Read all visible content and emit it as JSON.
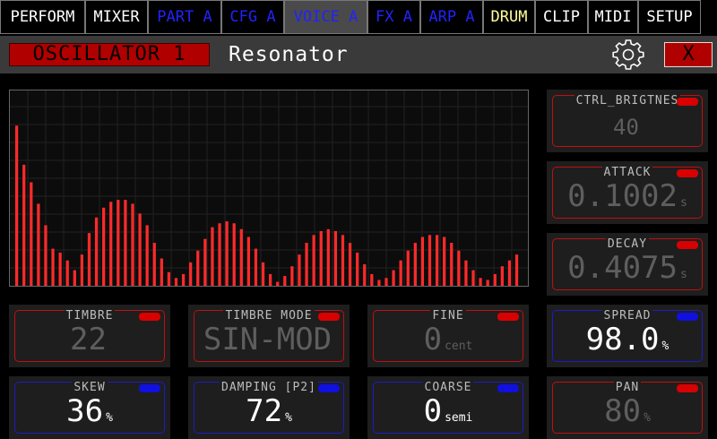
{
  "tabs": [
    {
      "label": "PERFORM",
      "color": "#ffffff",
      "active": false
    },
    {
      "label": "MIXER",
      "color": "#ffffff",
      "active": false
    },
    {
      "label": "PART A",
      "color": "#2222ff",
      "active": false
    },
    {
      "label": "CFG A",
      "color": "#2222ff",
      "active": false
    },
    {
      "label": "VOICE A",
      "color": "#2222ff",
      "active": true
    },
    {
      "label": "FX A",
      "color": "#2222ff",
      "active": false
    },
    {
      "label": "ARP A",
      "color": "#2222ff",
      "active": false
    },
    {
      "label": "DRUM",
      "color": "#ffff99",
      "active": false
    },
    {
      "label": "CLIP",
      "color": "#ffffff",
      "active": false
    },
    {
      "label": "MIDI",
      "color": "#ffffff",
      "active": false
    },
    {
      "label": "SETUP",
      "color": "#ffffff",
      "active": false
    }
  ],
  "header": {
    "oscillator_label": "OSCILLATOR 1",
    "model_name": "Resonator",
    "gear_icon": "gear-icon",
    "close_label": "X"
  },
  "spectrum": {
    "bar_color": "#ff2a2a",
    "levels": [
      0.82,
      0.62,
      0.53,
      0.42,
      0.31,
      0.19,
      0.17,
      0.13,
      0.08,
      0.16,
      0.27,
      0.35,
      0.4,
      0.43,
      0.44,
      0.44,
      0.42,
      0.37,
      0.31,
      0.22,
      0.14,
      0.07,
      0.04,
      0.06,
      0.12,
      0.18,
      0.24,
      0.3,
      0.32,
      0.33,
      0.32,
      0.29,
      0.25,
      0.19,
      0.12,
      0.06,
      0.02,
      0.05,
      0.1,
      0.16,
      0.22,
      0.26,
      0.28,
      0.29,
      0.28,
      0.26,
      0.22,
      0.17,
      0.11,
      0.06,
      0.03,
      0.04,
      0.08,
      0.13,
      0.18,
      0.22,
      0.25,
      0.26,
      0.26,
      0.25,
      0.22,
      0.18,
      0.13,
      0.08,
      0.04,
      0.03,
      0.06,
      0.1,
      0.13,
      0.16
    ]
  },
  "params": [
    {
      "label": "CTRL_BRIGTNES",
      "value": "40",
      "unit": "",
      "color": "red",
      "size": "small"
    },
    {
      "label": "ATTACK",
      "value": "0.1002",
      "unit": "s",
      "color": "red",
      "size": "large"
    },
    {
      "label": "DECAY",
      "value": "0.4075",
      "unit": "s",
      "color": "red",
      "size": "large"
    },
    {
      "label": "TIMBRE",
      "value": "22",
      "unit": "",
      "color": "red",
      "size": "large"
    },
    {
      "label": "TIMBRE MODE",
      "value": "SIN-MOD",
      "unit": "",
      "color": "red",
      "size": "large"
    },
    {
      "label": "FINE",
      "value": "0",
      "unit": "cent",
      "color": "red",
      "size": "large"
    },
    {
      "label": "SPREAD",
      "value": "98.0",
      "unit": "%",
      "color": "blue",
      "size": "large"
    },
    {
      "label": "SKEW",
      "value": "36",
      "unit": "%",
      "color": "blue",
      "size": "large"
    },
    {
      "label": "DAMPING [P2]",
      "value": "72",
      "unit": "%",
      "color": "blue",
      "size": "large"
    },
    {
      "label": "COARSE",
      "value": "0",
      "unit": "semi",
      "color": "blue",
      "size": "large"
    },
    {
      "label": "PAN",
      "value": "80",
      "unit": "%",
      "color": "red",
      "size": "large"
    }
  ]
}
